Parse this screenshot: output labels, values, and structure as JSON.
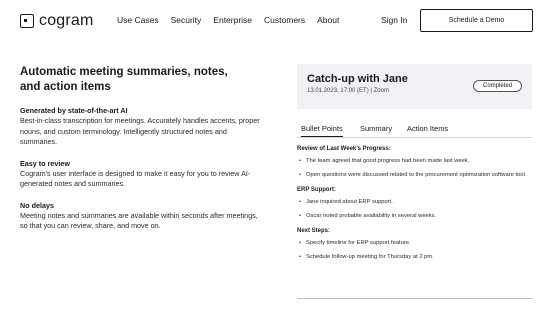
{
  "nav": {
    "logo": "cogram",
    "links": [
      "Use Cases",
      "Security",
      "Enterprise",
      "Customers",
      "About"
    ],
    "signin": "Sign In",
    "demo": "Schedule a Demo"
  },
  "left": {
    "heading": "Automatic meeting summaries, notes, and action items",
    "features": [
      {
        "title": "Generated by state-of-the-art AI",
        "desc": "Best-in-class transcription for meetings. Accurately handles accents, proper nouns, and custom terminology. Intelligently structured notes and summaries."
      },
      {
        "title": "Easy to review",
        "desc": "Cogram's user interface is designed to make it easy for you to review AI-generated notes and summaries."
      },
      {
        "title": "No delays",
        "desc": "Meeting notes and summaries are available within seconds after meetings, so that you can review, share, and move on."
      }
    ]
  },
  "card": {
    "title": "Catch-up with Jane",
    "subtitle": "13.01.2023, 17:00 (ET) | Zoom",
    "status": "Completed",
    "tabs": [
      "Bullet Points",
      "Summary",
      "Action Items"
    ],
    "sections": [
      {
        "title": "Review of Last Week's Progress:",
        "bullets": [
          "The team agreed that good progress had been made last week.",
          "Open questions were discussed related to the procurement optimization software tool."
        ]
      },
      {
        "title": "ERP Support:",
        "bullets": [
          "Jane inquired about ERP support.",
          "Oscar noted probable availability in several weeks."
        ]
      },
      {
        "title": "Next Steps:",
        "bullets": [
          "Specify timeline for ERP support feature.",
          "Schedule follow-up meeting for Thursday at 2 pm."
        ]
      }
    ]
  }
}
